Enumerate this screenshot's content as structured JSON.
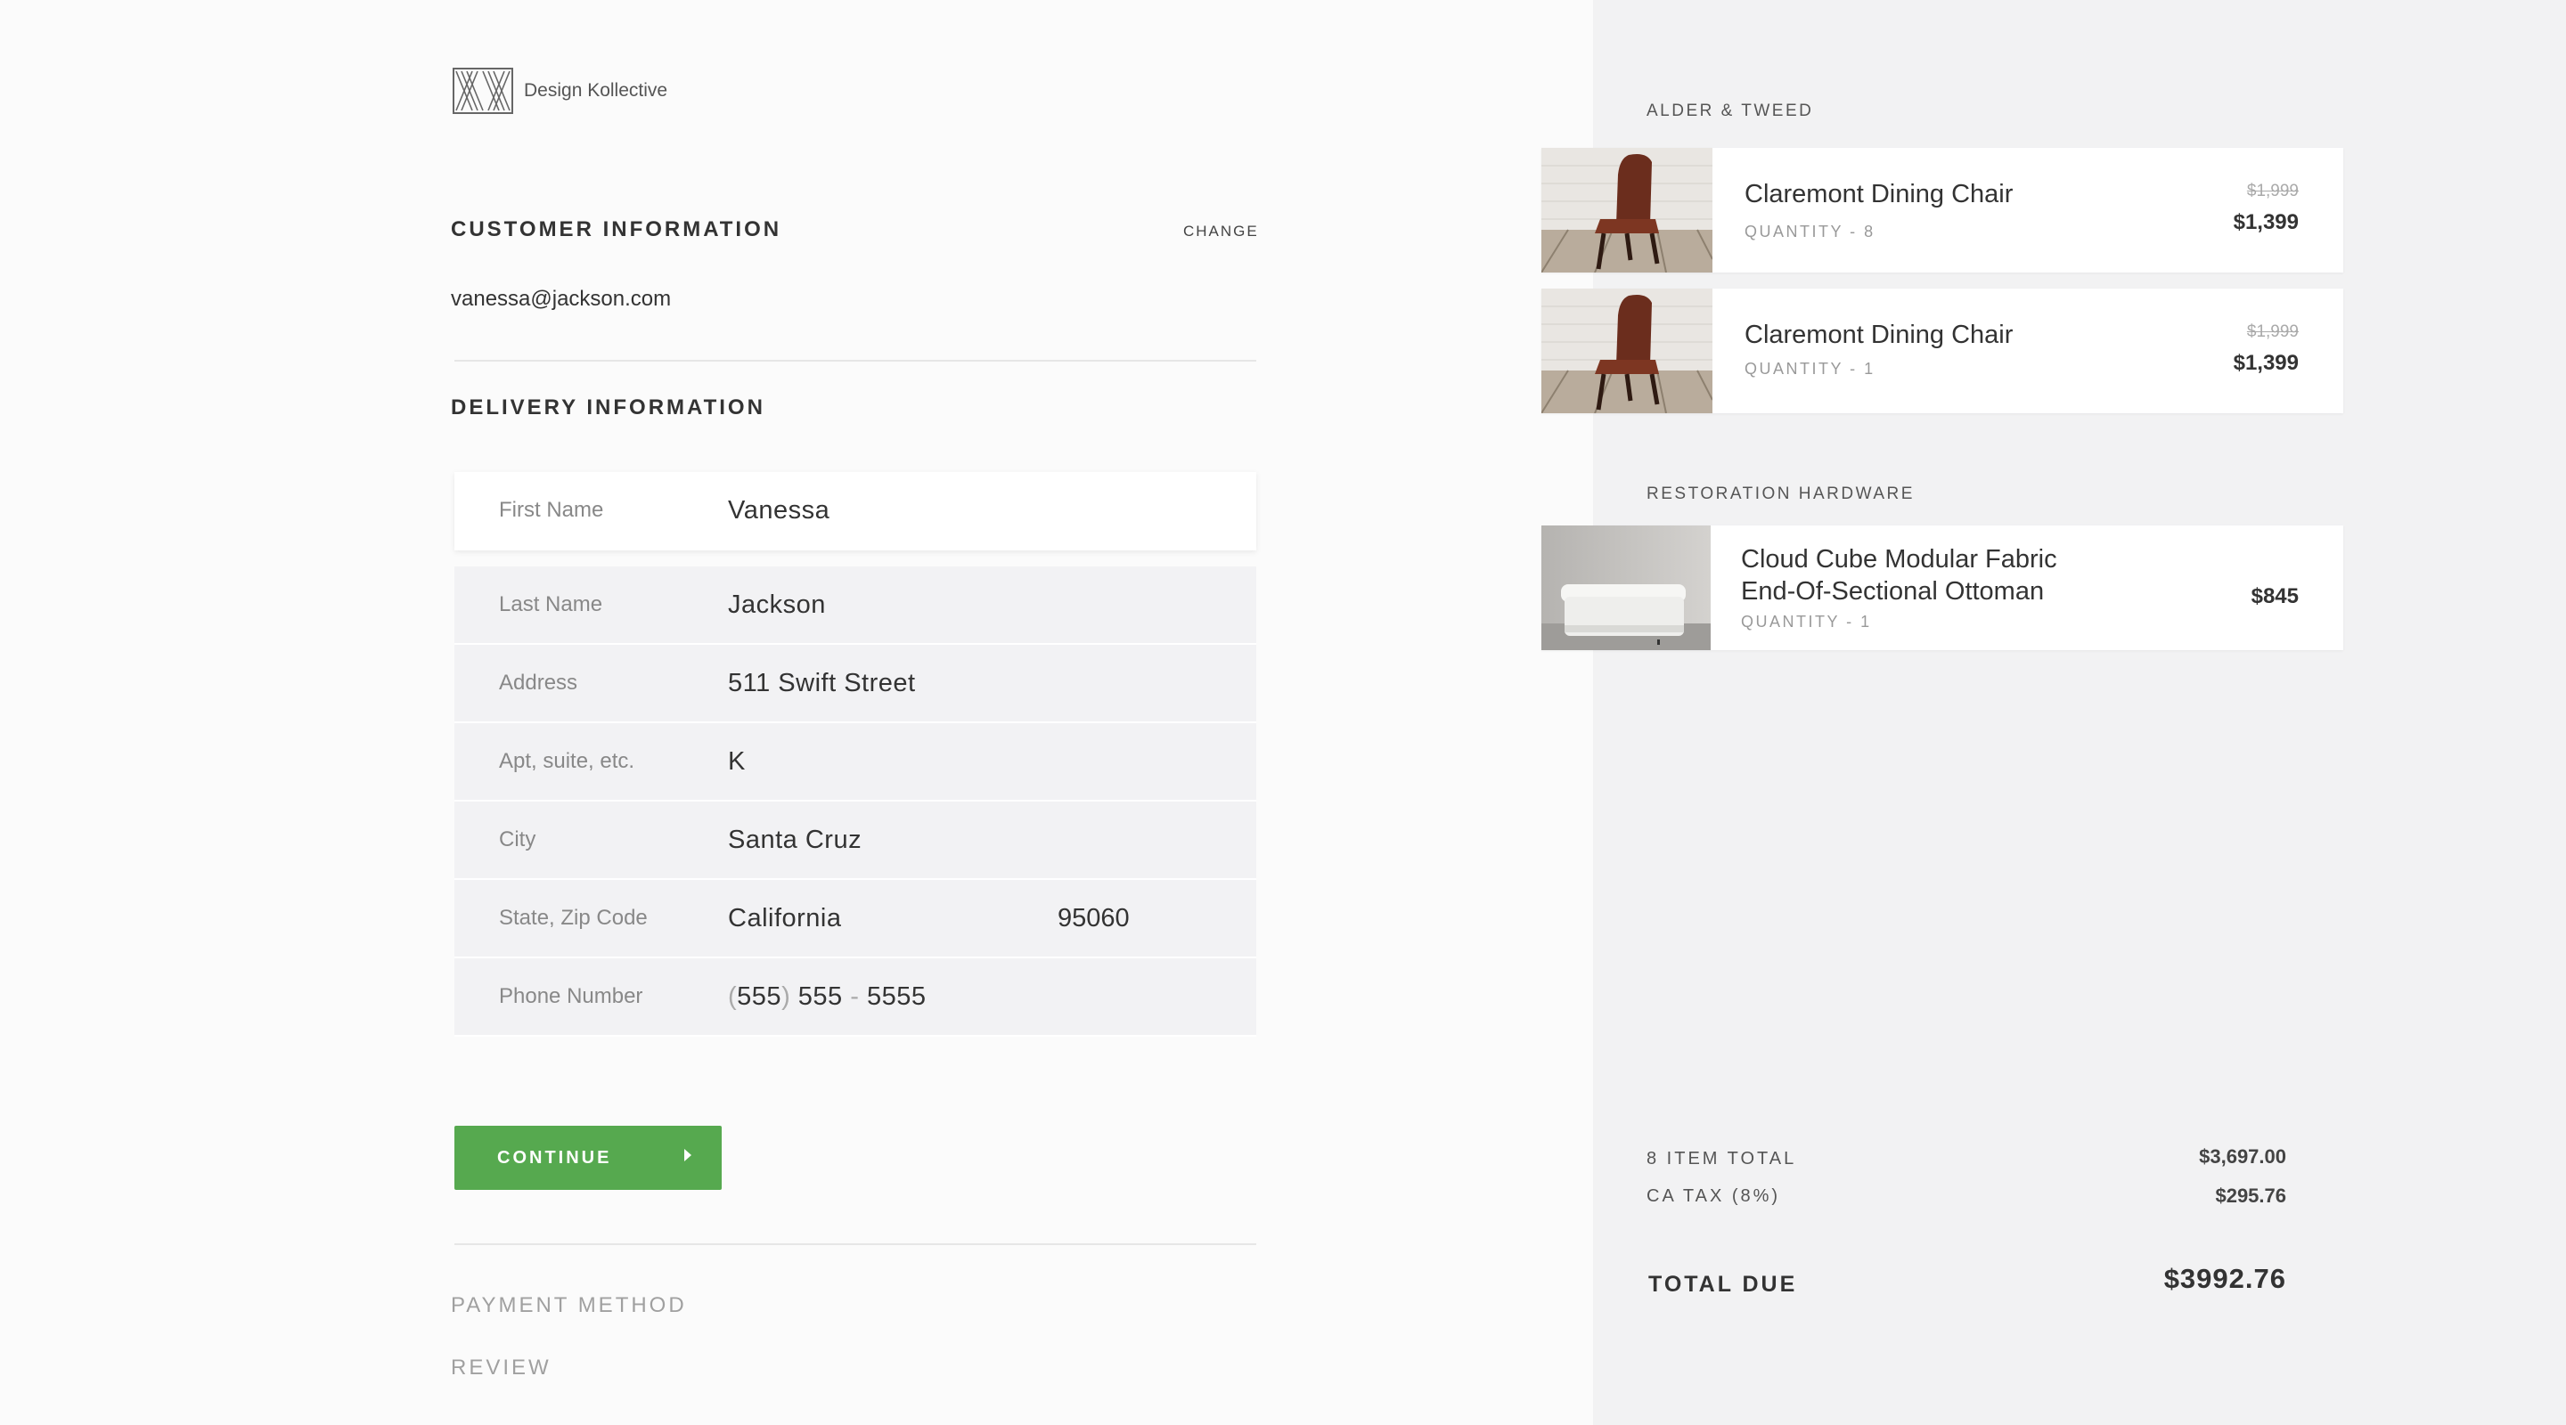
{
  "brand": {
    "name": "Design Kollective"
  },
  "customer": {
    "title": "CUSTOMER INFORMATION",
    "change_label": "CHANGE",
    "email": "vanessa@jackson.com"
  },
  "delivery": {
    "title": "DELIVERY INFORMATION",
    "fields": [
      {
        "label": "First Name",
        "value": "Vanessa"
      },
      {
        "label": "Last Name",
        "value": "Jackson"
      },
      {
        "label": "Address",
        "value": "511 Swift Street"
      },
      {
        "label": "Apt, suite, etc.",
        "value": "K"
      },
      {
        "label": "City",
        "value": "Santa Cruz"
      },
      {
        "label": "State, Zip Code",
        "value": "California",
        "value2": "95060"
      },
      {
        "label": "Phone Number",
        "area_code": "555",
        "prefix": "555",
        "line": "5555",
        "open_paren": "(",
        "close_paren": ")",
        "dash": "-"
      }
    ],
    "continue_label": "CONTINUE"
  },
  "steps": {
    "payment": "PAYMENT METHOD",
    "review": "REVIEW"
  },
  "cart": {
    "vendors": [
      {
        "name": "ALDER & TWEED",
        "items": [
          {
            "name": "Claremont Dining Chair",
            "quantity": "QUANTITY - 8",
            "original_price": "$1,999",
            "price": "$1,399",
            "thumb_icon": "leather-chair-icon"
          },
          {
            "name": "Claremont Dining Chair",
            "quantity": "QUANTITY - 1",
            "original_price": "$1,999",
            "price": "$1,399",
            "thumb_icon": "leather-chair-icon"
          }
        ]
      },
      {
        "name": "RESTORATION HARDWARE",
        "items": [
          {
            "name_line1": "Cloud Cube Modular Fabric",
            "name_line2": "End-Of-Sectional Ottoman",
            "quantity": "QUANTITY - 1",
            "price": "$845",
            "thumb_icon": "ottoman-icon"
          }
        ]
      }
    ]
  },
  "summary": {
    "item_total_label": "8 ITEM TOTAL",
    "item_total_value": "$3,697.00",
    "tax_label": "CA TAX (8%)",
    "tax_value": "$295.76",
    "total_label": "TOTAL DUE",
    "total_value": "$3992.76"
  },
  "colors": {
    "accent": "#56a94f",
    "panel": "#f2f2f3",
    "page": "#fbfbfb"
  }
}
